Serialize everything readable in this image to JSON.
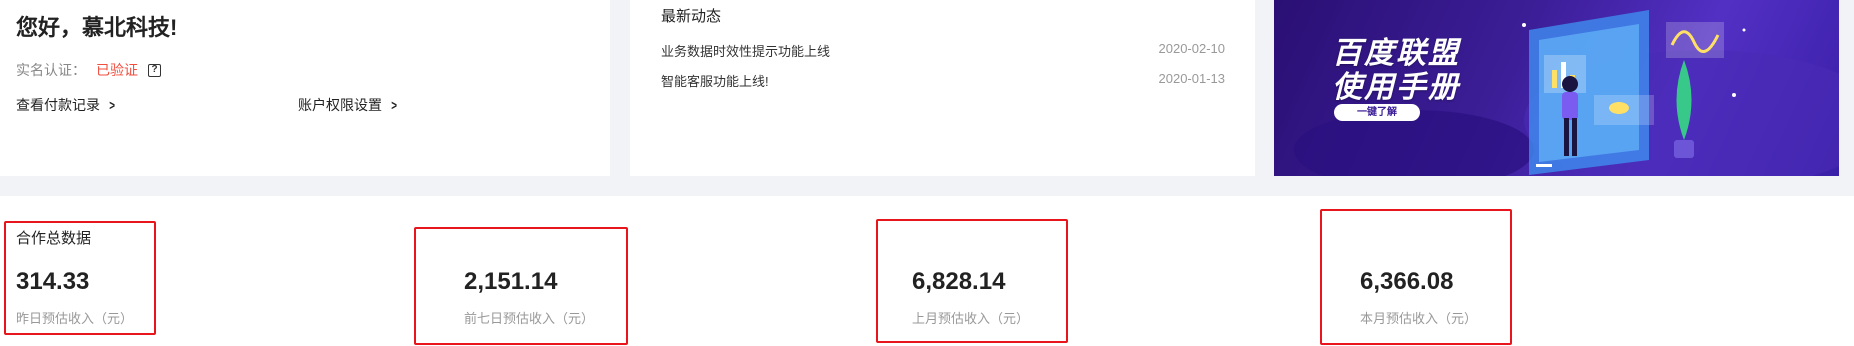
{
  "welcome": {
    "greeting": "您好，慕北科技!",
    "verify_label": "实名认证：",
    "verify_status": "已验证",
    "verify_help_icon": "help-icon",
    "payment_link": "查看付款记录",
    "permission_link": "账户权限设置"
  },
  "news": {
    "title": "最新动态",
    "items": [
      {
        "text": "业务数据时效性提示功能上线",
        "date": "2020-02-10"
      },
      {
        "text": "智能客服功能上线!",
        "date": "2020-01-13"
      }
    ]
  },
  "banner": {
    "line1": "百度联盟",
    "line2": "使用手册",
    "button": "一键了解",
    "slides": 2,
    "active_slide": 0
  },
  "stats": {
    "section_title": "合作总数据",
    "items": [
      {
        "value": "314.33",
        "label": "昨日预估收入（元）"
      },
      {
        "value": "2,151.14",
        "label": "前七日预估收入（元）"
      },
      {
        "value": "6,828.14",
        "label": "上月预估收入（元）"
      },
      {
        "value": "6,366.08",
        "label": "本月预估收入（元）"
      }
    ]
  },
  "colors": {
    "highlight": "#e8161c",
    "verified": "#f04e3e",
    "banner_bg": "#3b1d96"
  }
}
